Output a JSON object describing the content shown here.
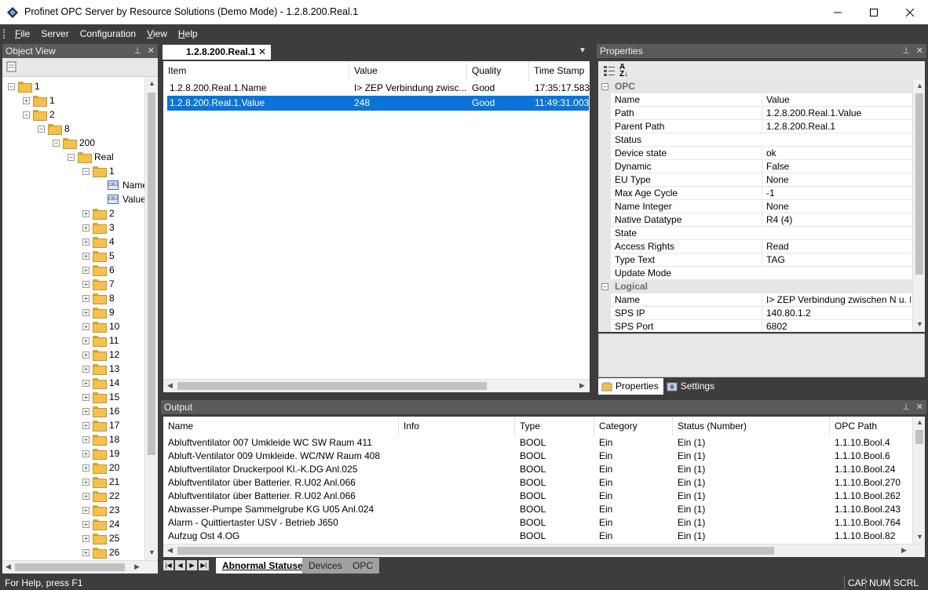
{
  "window": {
    "title": "Profinet OPC Server by Resource Solutions (Demo Mode) - 1.2.8.200.Real.1"
  },
  "menu": [
    {
      "label_ul": "F",
      "label_rest": "ile"
    },
    {
      "label_ul": "",
      "label_rest": "Server"
    },
    {
      "label_ul": "",
      "label_rest": "Configuration"
    },
    {
      "label_ul": "V",
      "label_rest": "iew"
    },
    {
      "label_ul": "H",
      "label_rest": "elp"
    }
  ],
  "object_view": {
    "title": "Object View",
    "tree": [
      {
        "label": "1",
        "level": 0,
        "kind": "folder",
        "exp": "-"
      },
      {
        "label": "1",
        "level": 1,
        "kind": "folder",
        "exp": "+"
      },
      {
        "label": "2",
        "level": 1,
        "kind": "folder",
        "exp": "-"
      },
      {
        "label": "8",
        "level": 2,
        "kind": "folder",
        "exp": "-"
      },
      {
        "label": "200",
        "level": 3,
        "kind": "folder",
        "exp": "-"
      },
      {
        "label": "Real",
        "level": 4,
        "kind": "folder",
        "exp": "-"
      },
      {
        "label": "1",
        "level": 5,
        "kind": "folder",
        "exp": "-"
      },
      {
        "label": "Name",
        "level": 6,
        "kind": "obj",
        "exp": ""
      },
      {
        "label": "Value",
        "level": 6,
        "kind": "obj",
        "exp": ""
      },
      {
        "label": "2",
        "level": 5,
        "kind": "folder",
        "exp": "+"
      },
      {
        "label": "3",
        "level": 5,
        "kind": "folder",
        "exp": "+"
      },
      {
        "label": "4",
        "level": 5,
        "kind": "folder",
        "exp": "+"
      },
      {
        "label": "5",
        "level": 5,
        "kind": "folder",
        "exp": "+"
      },
      {
        "label": "6",
        "level": 5,
        "kind": "folder",
        "exp": "+"
      },
      {
        "label": "7",
        "level": 5,
        "kind": "folder",
        "exp": "+"
      },
      {
        "label": "8",
        "level": 5,
        "kind": "folder",
        "exp": "+"
      },
      {
        "label": "9",
        "level": 5,
        "kind": "folder",
        "exp": "+"
      },
      {
        "label": "10",
        "level": 5,
        "kind": "folder",
        "exp": "+"
      },
      {
        "label": "11",
        "level": 5,
        "kind": "folder",
        "exp": "+"
      },
      {
        "label": "12",
        "level": 5,
        "kind": "folder",
        "exp": "+"
      },
      {
        "label": "13",
        "level": 5,
        "kind": "folder",
        "exp": "+"
      },
      {
        "label": "14",
        "level": 5,
        "kind": "folder",
        "exp": "+"
      },
      {
        "label": "15",
        "level": 5,
        "kind": "folder",
        "exp": "+"
      },
      {
        "label": "16",
        "level": 5,
        "kind": "folder",
        "exp": "+"
      },
      {
        "label": "17",
        "level": 5,
        "kind": "folder",
        "exp": "+"
      },
      {
        "label": "18",
        "level": 5,
        "kind": "folder",
        "exp": "+"
      },
      {
        "label": "19",
        "level": 5,
        "kind": "folder",
        "exp": "+"
      },
      {
        "label": "20",
        "level": 5,
        "kind": "folder",
        "exp": "+"
      },
      {
        "label": "21",
        "level": 5,
        "kind": "folder",
        "exp": "+"
      },
      {
        "label": "22",
        "level": 5,
        "kind": "folder",
        "exp": "+"
      },
      {
        "label": "23",
        "level": 5,
        "kind": "folder",
        "exp": "+"
      },
      {
        "label": "24",
        "level": 5,
        "kind": "folder",
        "exp": "+"
      },
      {
        "label": "25",
        "level": 5,
        "kind": "folder",
        "exp": "+"
      },
      {
        "label": "26",
        "level": 5,
        "kind": "folder",
        "exp": "+"
      }
    ]
  },
  "document": {
    "tab_label": "1.2.8.200.Real.1",
    "columns": [
      "Item",
      "Value",
      "Quality",
      "Time Stamp"
    ],
    "rows": [
      {
        "item": "1.2.8.200.Real.1.Name",
        "value": "I> ZEP Verbindung zwisc...",
        "quality": "Good",
        "timestamp": "17:35:17.583",
        "selected": false
      },
      {
        "item": "1.2.8.200.Real.1.Value",
        "value": "248",
        "quality": "Good",
        "timestamp": "11:49:31.003",
        "selected": true
      }
    ]
  },
  "properties": {
    "title": "Properties",
    "categories": [
      {
        "name": "OPC",
        "items": [
          {
            "name": "Name",
            "value": "Value"
          },
          {
            "name": "Path",
            "value": "1.2.8.200.Real.1.Value"
          },
          {
            "name": "Parent Path",
            "value": "1.2.8.200.Real.1"
          },
          {
            "name": "Status",
            "value": ""
          },
          {
            "name": "Device state",
            "value": "ok"
          },
          {
            "name": "Dynamic",
            "value": "False"
          },
          {
            "name": "EU Type",
            "value": "None"
          },
          {
            "name": "Max Age Cycle",
            "value": "-1"
          },
          {
            "name": "Name Integer",
            "value": "None"
          },
          {
            "name": "Native Datatype",
            "value": "R4 (4)"
          },
          {
            "name": "State",
            "value": ""
          },
          {
            "name": "Access Rights",
            "value": "Read"
          },
          {
            "name": "Type Text",
            "value": "TAG"
          },
          {
            "name": "Update Mode",
            "value": ""
          }
        ]
      },
      {
        "name": "Logical",
        "items": [
          {
            "name": "Name",
            "value": "I> ZEP Verbindung zwischen N u. P..."
          },
          {
            "name": "SPS IP",
            "value": "140.80.1.2"
          },
          {
            "name": "SPS Port",
            "value": "6802"
          }
        ]
      }
    ],
    "tabs": [
      {
        "label": "Properties",
        "active": true
      },
      {
        "label": "Settings",
        "active": false
      }
    ]
  },
  "output": {
    "title": "Output",
    "columns": [
      "Name",
      "Info",
      "Type",
      "Category",
      "Status (Number)",
      "OPC Path"
    ],
    "rows": [
      {
        "name": "Abluftventilator 007 Umkleide WC SW Raum 411",
        "info": "",
        "type": "BOOL",
        "category": "Ein",
        "status": "Ein (1)",
        "path": "1.1.10.Bool.4"
      },
      {
        "name": "Abluft-Ventilator 009 Umkleide. WC/NW Raum 408",
        "info": "",
        "type": "BOOL",
        "category": "Ein",
        "status": "Ein (1)",
        "path": "1.1.10.Bool.6"
      },
      {
        "name": "Abluftventilator Druckerpool Kl.-K.DG   Anl.025",
        "info": "",
        "type": "BOOL",
        "category": "Ein",
        "status": "Ein (1)",
        "path": "1.1.10.Bool.24"
      },
      {
        "name": "Abluftventilator über Batterier. R.U02  Anl.066",
        "info": "",
        "type": "BOOL",
        "category": "Ein",
        "status": "Ein (1)",
        "path": "1.1.10.Bool.270"
      },
      {
        "name": "Abluftventilator über Batterier. R.U02  Anl.066",
        "info": "",
        "type": "BOOL",
        "category": "Ein",
        "status": "Ein (1)",
        "path": "1.1.10.Bool.262"
      },
      {
        "name": "Abwasser-Pumpe Sammelgrube KG U05  Anl.024",
        "info": "",
        "type": "BOOL",
        "category": "Ein",
        "status": "Ein (1)",
        "path": "1.1.10.Bool.243"
      },
      {
        "name": "Alarm - Quittiertaster USV - Betrieb J650",
        "info": "",
        "type": "BOOL",
        "category": "Ein",
        "status": "Ein (1)",
        "path": "1.1.10.Bool.764"
      },
      {
        "name": "Aufzug Ost 4.OG",
        "info": "",
        "type": "BOOL",
        "category": "Ein",
        "status": "Ein (1)",
        "path": "1.1.10.Bool.82"
      }
    ],
    "tabs": [
      {
        "label": "Abnormal Statuses",
        "active": true
      },
      {
        "label": "Devices",
        "active": false
      },
      {
        "label": "OPC",
        "active": false
      }
    ]
  },
  "statusbar": {
    "help_text": "For Help, press F1",
    "indicators": [
      "CAP",
      "NUM",
      "SCRL"
    ]
  },
  "colors": {
    "selection": "#0a74d8",
    "chrome_dark": "#3d3d3d",
    "pane_header": "#5a5a5a"
  }
}
